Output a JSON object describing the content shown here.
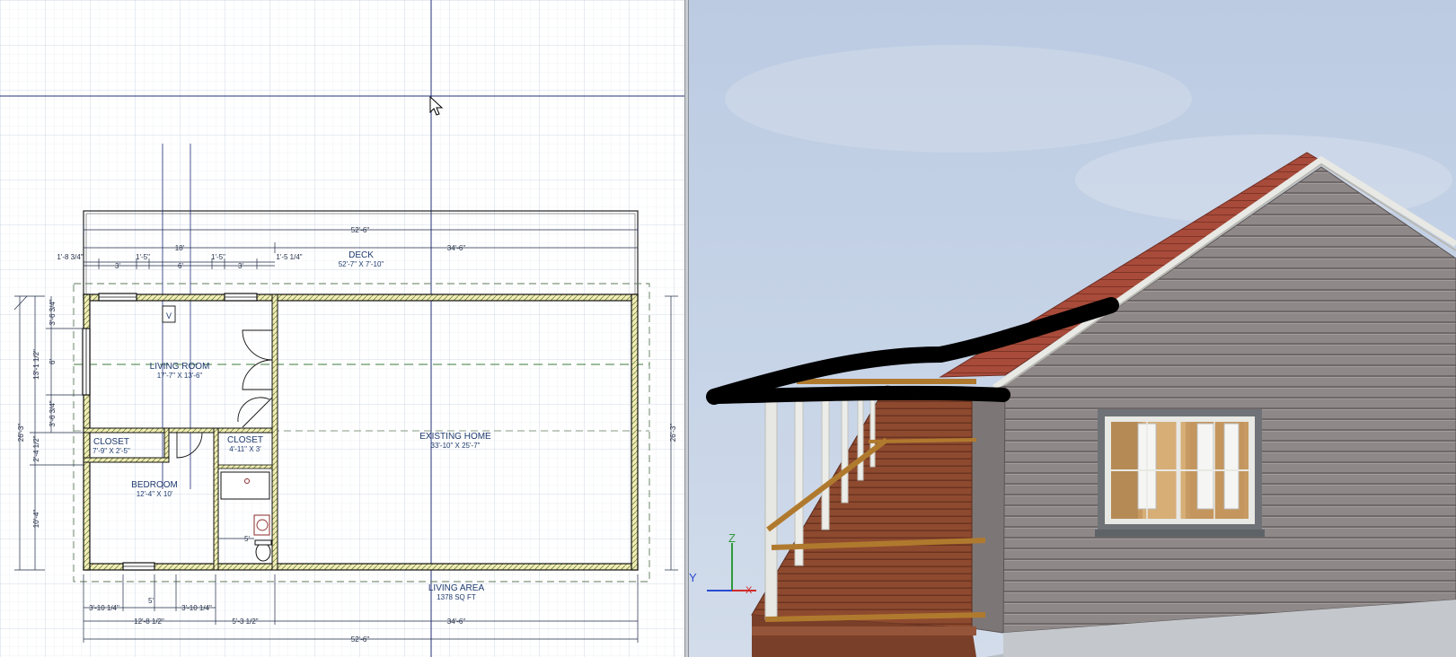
{
  "plan": {
    "rooms": {
      "deck": {
        "name": "DECK",
        "size": "52'-7\" X 7'-10\""
      },
      "living_room": {
        "name": "LIVING ROOM",
        "size": "17'-7\" X 13'-6\""
      },
      "existing_home": {
        "name": "EXISTING HOME",
        "size": "33'-10\" X 25'-7\""
      },
      "closet1": {
        "name": "CLOSET",
        "size": "7'-9\" X 2'-5\""
      },
      "closet2": {
        "name": "CLOSET",
        "size": "4'-11\" X 3'"
      },
      "bedroom": {
        "name": "BEDROOM",
        "size": "12'-4\" X 10'"
      },
      "living_area": {
        "name": "LIVING AREA",
        "size": "1378 SQ FT"
      }
    },
    "dims": {
      "top_total": "52'-6\"",
      "top_left": "18'",
      "top_right": "34'-6\"",
      "d_1_8_3_4": "1'-8 3/4\"",
      "d_1_5_a": "1'-5\"",
      "d_1_5_b": "1'-5\"",
      "d_1_5_1_4": "1'-5 1/4\"",
      "d_3_a": "3'",
      "d_6": "6'",
      "d_3_b": "3'",
      "bot_3_10_a": "3'-10 1/4\"",
      "bot_5": "5'",
      "bot_3_10_b": "3'-10 1/4\"",
      "bot_12_8": "12'-8 1/2\"",
      "bot_5_3": "5'-3 1/2\"",
      "bot_34_6": "34'-6\"",
      "bot_total": "52'-6\"",
      "left_26_3": "26'-3\"",
      "left_13_1": "13'-1 1/2\"",
      "left_2_4": "2'-4 1/2\"",
      "left_10_4": "10'-4\"",
      "left_3_6_a": "3'-6 3/4\"",
      "left_6": "6'",
      "left_3_6_b": "3'-6 3/4\"",
      "right_26_3": "26'-3\"",
      "bath_5": "5'"
    },
    "fixture": "V"
  },
  "view3d": {
    "axis_y": "Y",
    "axis_z": "Z",
    "axis_x": "X"
  },
  "colors": {
    "grid": "#d3dbe6",
    "wall": "#1a1a1a",
    "wall_fill": "#f2ecc0",
    "label": "#1e3a6e",
    "crosshair": "#1f2d7a",
    "sky": "#c2d0e6",
    "siding": "#8c8586",
    "roof": "#a5493a",
    "deck": "#8e4a30"
  }
}
